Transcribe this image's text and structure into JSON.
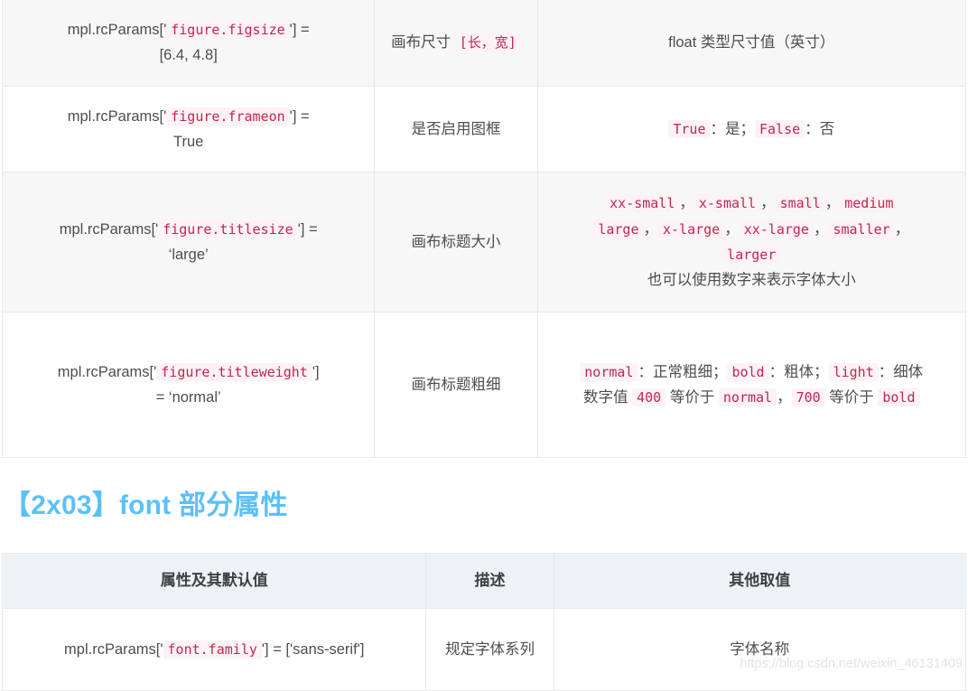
{
  "tables": [
    {
      "name": "figure-properties-table",
      "rows": [
        {
          "shaded": true,
          "property_prefix": "mpl.rcParams['",
          "property_code": "figure.figsize",
          "property_suffix": "'] =",
          "property_value": "[6.4, 4.8]",
          "description_text": "画布尺寸",
          "description_code": "[长，宽]",
          "values_plain": "float 类型尺寸值（英寸）"
        },
        {
          "shaded": false,
          "property_prefix": "mpl.rcParams['",
          "property_code": "figure.frameon",
          "property_suffix": "'] =",
          "property_value": "True",
          "description_text": "是否启用图框",
          "values_true": "True",
          "values_true_label": "：是；",
          "values_false": "False",
          "values_false_label": "：否"
        },
        {
          "shaded": true,
          "property_prefix": "mpl.rcParams['",
          "property_code": "figure.titlesize",
          "property_suffix": "'] =",
          "property_value": "‘large’",
          "description_text": "画布标题大小",
          "size_keywords_line1": [
            "xx-small",
            "x-small",
            "small",
            "medium"
          ],
          "size_keywords_line2": [
            "large",
            "x-large",
            "xx-large",
            "smaller"
          ],
          "size_keywords_line3": [
            "larger"
          ],
          "size_note": "也可以使用数字来表示字体大小"
        },
        {
          "shaded": false,
          "property_prefix": "mpl.rcParams['",
          "property_code": "figure.titleweight",
          "property_suffix": "']",
          "property_value": "= ‘normal’",
          "description_text": "画布标题粗细",
          "weight_normal": "normal",
          "weight_normal_label": "：正常粗细；",
          "weight_bold": "bold",
          "weight_bold_label": "：粗体；",
          "weight_light": "light",
          "weight_light_label": "：",
          "weight_light_value": "细体",
          "numeric_prefix": "数字值",
          "numeric_400": "400",
          "numeric_mid1": "等价于",
          "numeric_normal": "normal",
          "numeric_comma": "，",
          "numeric_700": "700",
          "numeric_mid2": "等价于",
          "numeric_bold": "bold"
        }
      ]
    },
    {
      "name": "font-properties-table",
      "headers": [
        "属性及其默认值",
        "描述",
        "其他取值"
      ],
      "rows": [
        {
          "property_prefix": "mpl.rcParams['",
          "property_code": "font.family",
          "property_suffix": "'] = ['sans-serif']",
          "description_text": "规定字体系列",
          "values_plain": "字体名称"
        }
      ]
    }
  ],
  "heading": {
    "text": "【2x03】font 部分属性"
  },
  "watermark": {
    "text": "https://blog.csdn.net/weixin_46131409"
  },
  "colors": {
    "heading": "#5bc0f8",
    "code_text": "#c0274e",
    "code_background": "#fdf2f5",
    "row_shaded": "#f7f7f7",
    "header_background": "#edf2f7",
    "border": "#e8e8e8",
    "body_text": "#4d4d4d",
    "watermark": "#e3e3e3"
  }
}
